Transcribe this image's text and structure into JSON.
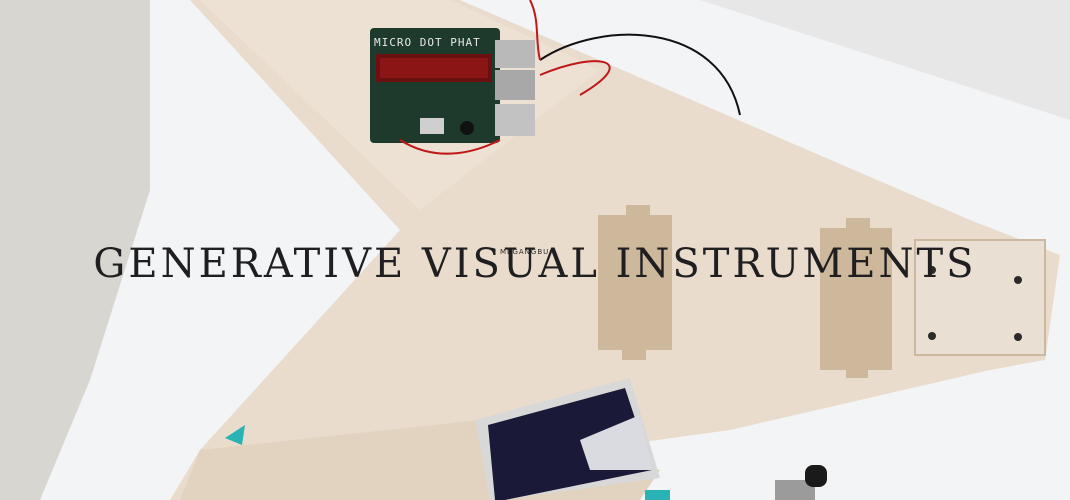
{
  "hero": {
    "title": "GENERATIVE VISUAL INSTRUMENTS",
    "subtitle": "MEGANGBU"
  },
  "board": {
    "label": "MICRO DOT PHAT"
  },
  "colors": {
    "text": "#1f1f22",
    "wood": "#e9ddd0",
    "paper": "#f4f4f6",
    "floor": "#d9d8d4",
    "pcb": "#1d3a2c",
    "display": "#8b1414",
    "accent_teal": "#2ab3b5"
  }
}
